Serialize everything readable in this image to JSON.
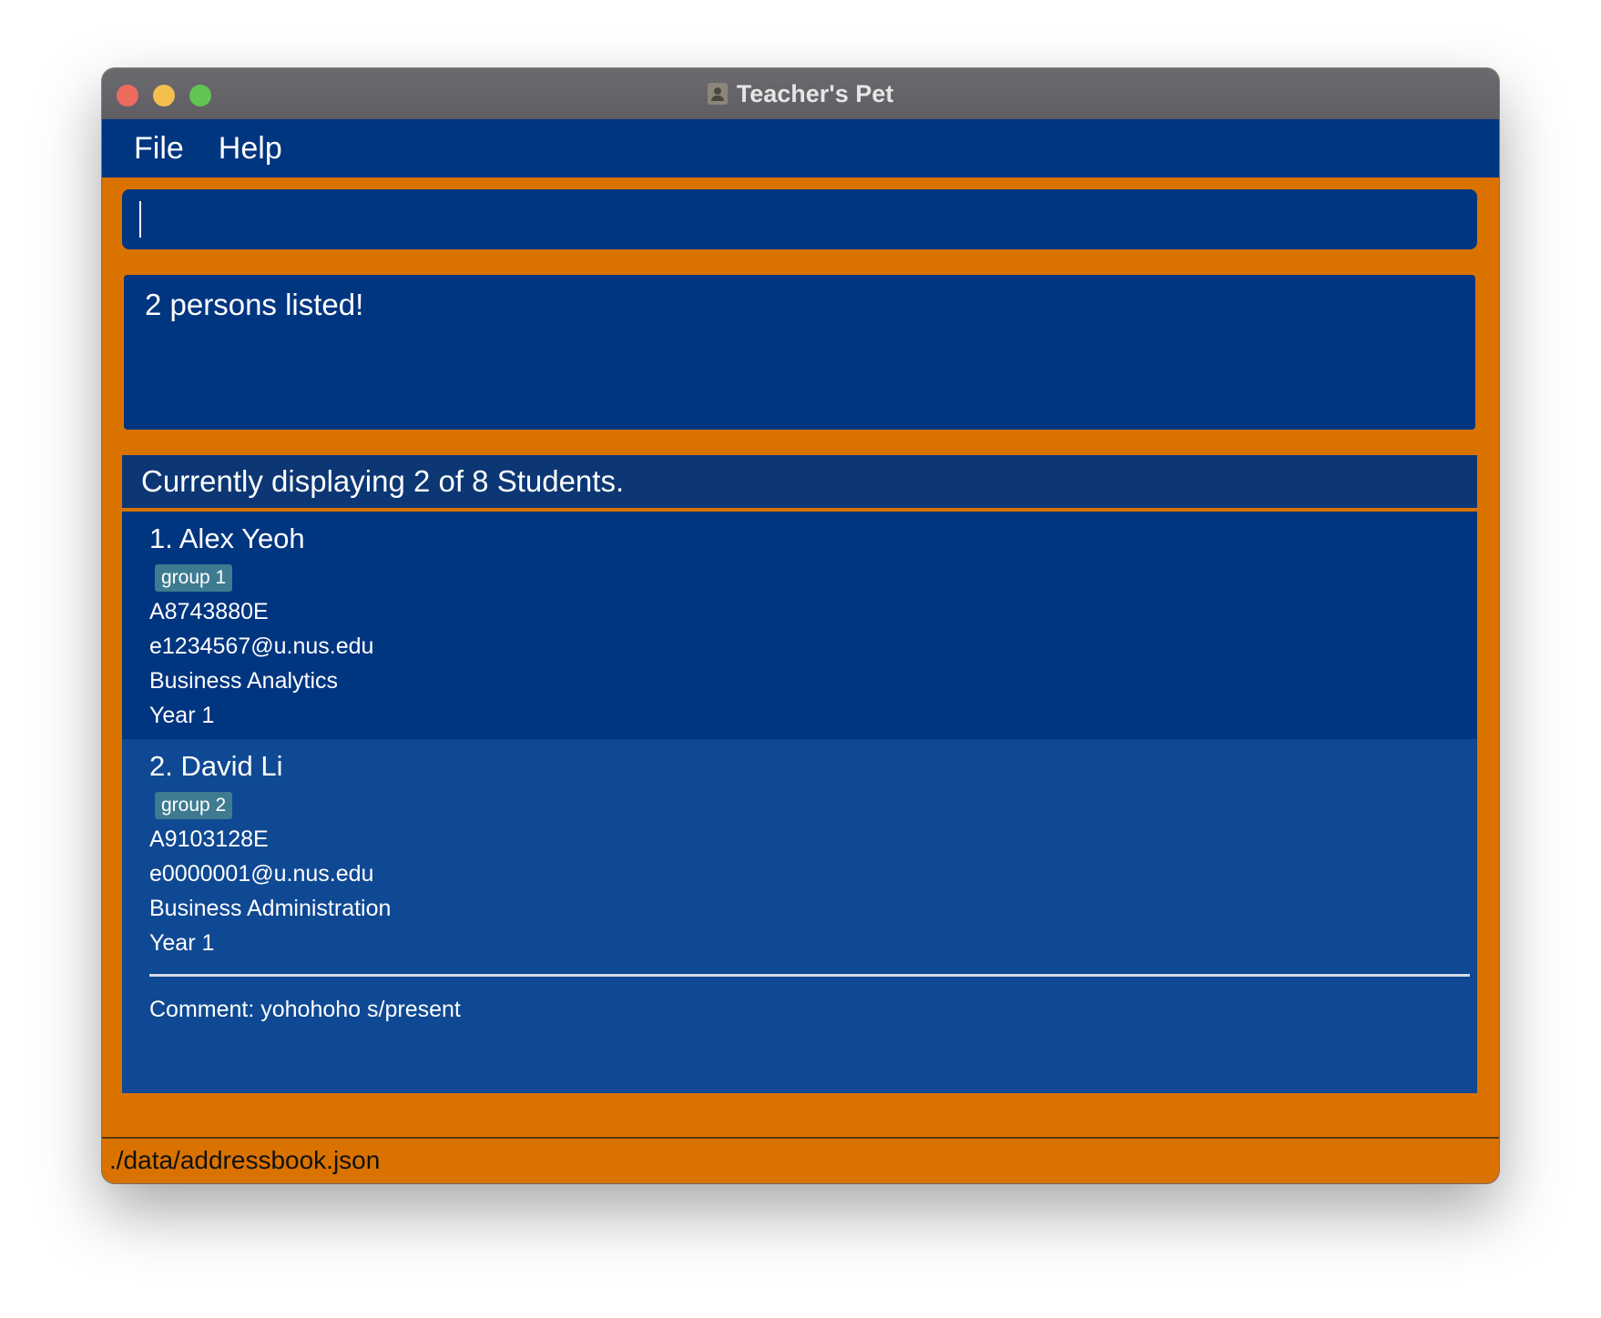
{
  "window": {
    "title": "Teacher's Pet",
    "icon": "person-icon"
  },
  "menu": {
    "file": "File",
    "help": "Help"
  },
  "command_box": {
    "value": ""
  },
  "result": {
    "message": "2 persons listed!"
  },
  "list": {
    "header": "Currently displaying 2 of 8 Students.",
    "students": [
      {
        "name": "1. Alex Yeoh",
        "tag": "group 1",
        "student_id": "A8743880E",
        "email": "e1234567@u.nus.edu",
        "major": "Business Analytics",
        "year": "Year 1"
      },
      {
        "name": "2. David Li",
        "tag": "group 2",
        "student_id": "A9103128E",
        "email": "e0000001@u.nus.edu",
        "major": "Business Administration",
        "year": "Year 1",
        "comment": "Comment: yohohoho s/present"
      }
    ]
  },
  "status_bar": {
    "path": "./data/addressbook.json"
  },
  "colors": {
    "accent": "#da7200",
    "panel": "#003580",
    "selected_card": "#0f4993",
    "tag": "#3e7b91"
  }
}
